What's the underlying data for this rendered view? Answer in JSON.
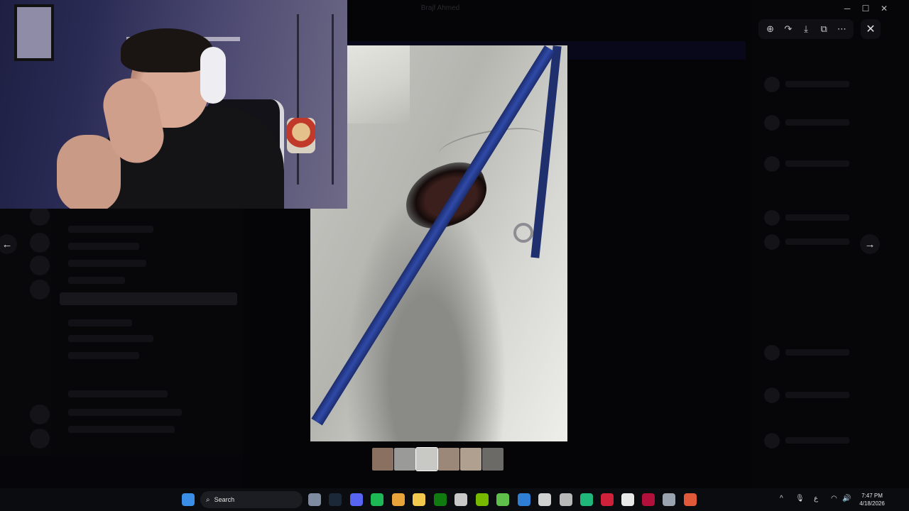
{
  "window": {
    "title": "Brajf Ahmed",
    "minimize": "─",
    "maximize": "☐",
    "close": "✕"
  },
  "viewer": {
    "toolbar": [
      {
        "name": "zoom-icon",
        "glyph": "⊕"
      },
      {
        "name": "forward-icon",
        "glyph": "↷"
      },
      {
        "name": "download-icon",
        "glyph": "⤓"
      },
      {
        "name": "open-external-icon",
        "glyph": "⧉"
      },
      {
        "name": "more-icon",
        "glyph": "⋯"
      }
    ],
    "close_glyph": "✕",
    "prev_glyph": "←",
    "next_glyph": "→",
    "thumbnails": [
      {
        "name": "thumbnail-1",
        "color": "#8a7060"
      },
      {
        "name": "thumbnail-2",
        "color": "#9a9a98"
      },
      {
        "name": "thumbnail-3",
        "color": "#c8c8c4"
      },
      {
        "name": "thumbnail-4",
        "color": "#9c8878"
      },
      {
        "name": "thumbnail-5",
        "color": "#b0a090"
      },
      {
        "name": "thumbnail-6",
        "color": "#6c6a66"
      }
    ]
  },
  "taskbar": {
    "search_label": "Search",
    "time": "7:47 PM",
    "date": "4/18/2026",
    "icons": [
      {
        "name": "start-icon",
        "color": "#3a8ee6"
      },
      {
        "name": "camera-app-icon",
        "color": "#7f8ba0"
      },
      {
        "name": "steam-icon",
        "color": "#1b2838"
      },
      {
        "name": "discord-icon",
        "color": "#5865f2"
      },
      {
        "name": "spotify-icon",
        "color": "#1db954"
      },
      {
        "name": "chrome-icon",
        "color": "#e8a33a"
      },
      {
        "name": "file-explorer-icon",
        "color": "#f2c94c"
      },
      {
        "name": "xbox-icon",
        "color": "#107c10"
      },
      {
        "name": "store-icon",
        "color": "#c8c8c8"
      },
      {
        "name": "nvidia-icon",
        "color": "#76b900"
      },
      {
        "name": "play-app-icon",
        "color": "#5fbf4a"
      },
      {
        "name": "app-blue-icon",
        "color": "#2f7fd6"
      },
      {
        "name": "app-g-icon",
        "color": "#d0d0d0"
      },
      {
        "name": "recycle-icon",
        "color": "#b8b8b8"
      },
      {
        "name": "app-green-icon",
        "color": "#1fb77a"
      },
      {
        "name": "app-red-icon",
        "color": "#d0213b"
      },
      {
        "name": "capcut-icon",
        "color": "#e8e8e8"
      },
      {
        "name": "app-a-icon",
        "color": "#b0103a"
      },
      {
        "name": "settings-icon",
        "color": "#9aa3b0"
      },
      {
        "name": "chrome-2-icon",
        "color": "#e05a3a"
      }
    ],
    "tray": {
      "chevron": "^",
      "mic": "🎙",
      "lang": "ع",
      "wifi": "◠",
      "volume": "🔊",
      "battery": "▭"
    }
  }
}
